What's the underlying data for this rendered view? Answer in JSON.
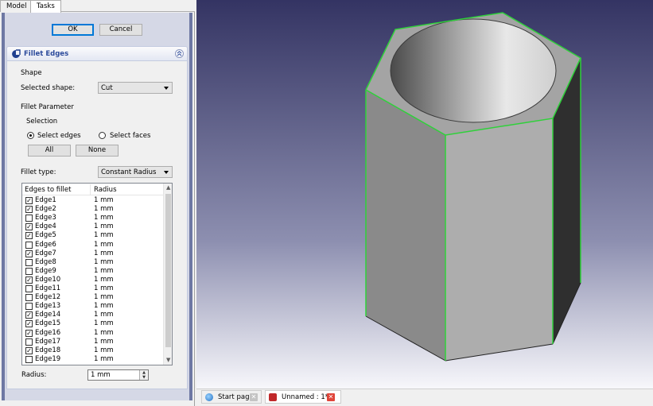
{
  "tabs": {
    "model": "Model",
    "tasks": "Tasks"
  },
  "buttons": {
    "ok": "OK",
    "cancel": "Cancel"
  },
  "fillet": {
    "title": "Fillet Edges",
    "shape_label": "Shape",
    "selected_shape_label": "Selected shape:",
    "selected_shape_value": "Cut",
    "fillet_parameter_label": "Fillet Parameter",
    "selection_label": "Selection",
    "select_edges": "Select edges",
    "select_faces": "Select faces",
    "select_mode": "edges",
    "all_button": "All",
    "none_button": "None",
    "fillet_type_label": "Fillet type:",
    "fillet_type_value": "Constant Radius",
    "list_headers": {
      "edges": "Edges to fillet",
      "radius": "Radius"
    },
    "edges": [
      {
        "name": "Edge1",
        "radius": "1 mm",
        "checked": true
      },
      {
        "name": "Edge2",
        "radius": "1 mm",
        "checked": true
      },
      {
        "name": "Edge3",
        "radius": "1 mm",
        "checked": false
      },
      {
        "name": "Edge4",
        "radius": "1 mm",
        "checked": true
      },
      {
        "name": "Edge5",
        "radius": "1 mm",
        "checked": true
      },
      {
        "name": "Edge6",
        "radius": "1 mm",
        "checked": false
      },
      {
        "name": "Edge7",
        "radius": "1 mm",
        "checked": true
      },
      {
        "name": "Edge8",
        "radius": "1 mm",
        "checked": false
      },
      {
        "name": "Edge9",
        "radius": "1 mm",
        "checked": false
      },
      {
        "name": "Edge10",
        "radius": "1 mm",
        "checked": true
      },
      {
        "name": "Edge11",
        "radius": "1 mm",
        "checked": false
      },
      {
        "name": "Edge12",
        "radius": "1 mm",
        "checked": false
      },
      {
        "name": "Edge13",
        "radius": "1 mm",
        "checked": false
      },
      {
        "name": "Edge14",
        "radius": "1 mm",
        "checked": true
      },
      {
        "name": "Edge15",
        "radius": "1 mm",
        "checked": true
      },
      {
        "name": "Edge16",
        "radius": "1 mm",
        "checked": true
      },
      {
        "name": "Edge17",
        "radius": "1 mm",
        "checked": false
      },
      {
        "name": "Edge18",
        "radius": "1 mm",
        "checked": true
      },
      {
        "name": "Edge19",
        "radius": "1 mm",
        "checked": false
      }
    ],
    "radius_label": "Radius:",
    "radius_value": "1 mm"
  },
  "document_tabs": [
    {
      "label": "Start page",
      "active": false
    },
    {
      "label": "Unnamed : 1*",
      "active": true
    }
  ],
  "colors": {
    "selected_edge": "#2fd13a",
    "close_button": "#e0453a",
    "panel_title": "#2b4a9b"
  },
  "icons": {
    "fillet": "fillet-edges-icon",
    "collapse": "collapse-chevron-icon",
    "start_page": "start-page-icon",
    "document": "freecad-document-icon",
    "close": "close-icon"
  }
}
